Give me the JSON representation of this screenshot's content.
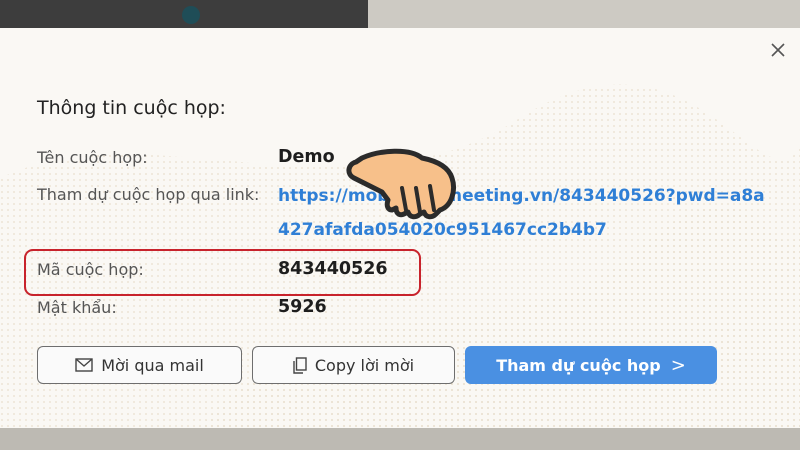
{
  "modal": {
    "title": "Thông tin cuộc họp:",
    "close_icon": "close-icon",
    "fields": {
      "meeting_name_label": "Tên cuộc họp:",
      "meeting_name_value": "Demo",
      "link_label": "Tham dự cuộc họp qua link:",
      "link_line1": "https://mobifone.meeting.vn/843440526?pwd=a8a",
      "link_line2": "427afafda054020c951467cc2b4b7",
      "meeting_id_label": "Mã cuộc họp:",
      "meeting_id_value": "843440526",
      "password_label": "Mật khẩu:",
      "password_value": "5926"
    },
    "buttons": {
      "mail_label": "Mời qua mail",
      "copy_label": "Copy lời mời",
      "join_label": "Tham dự cuộc họp",
      "join_chevron": ">"
    }
  },
  "colors": {
    "link": "#2f7fd6",
    "primary_button": "#4a90e2",
    "highlight_border": "#c8232c"
  }
}
